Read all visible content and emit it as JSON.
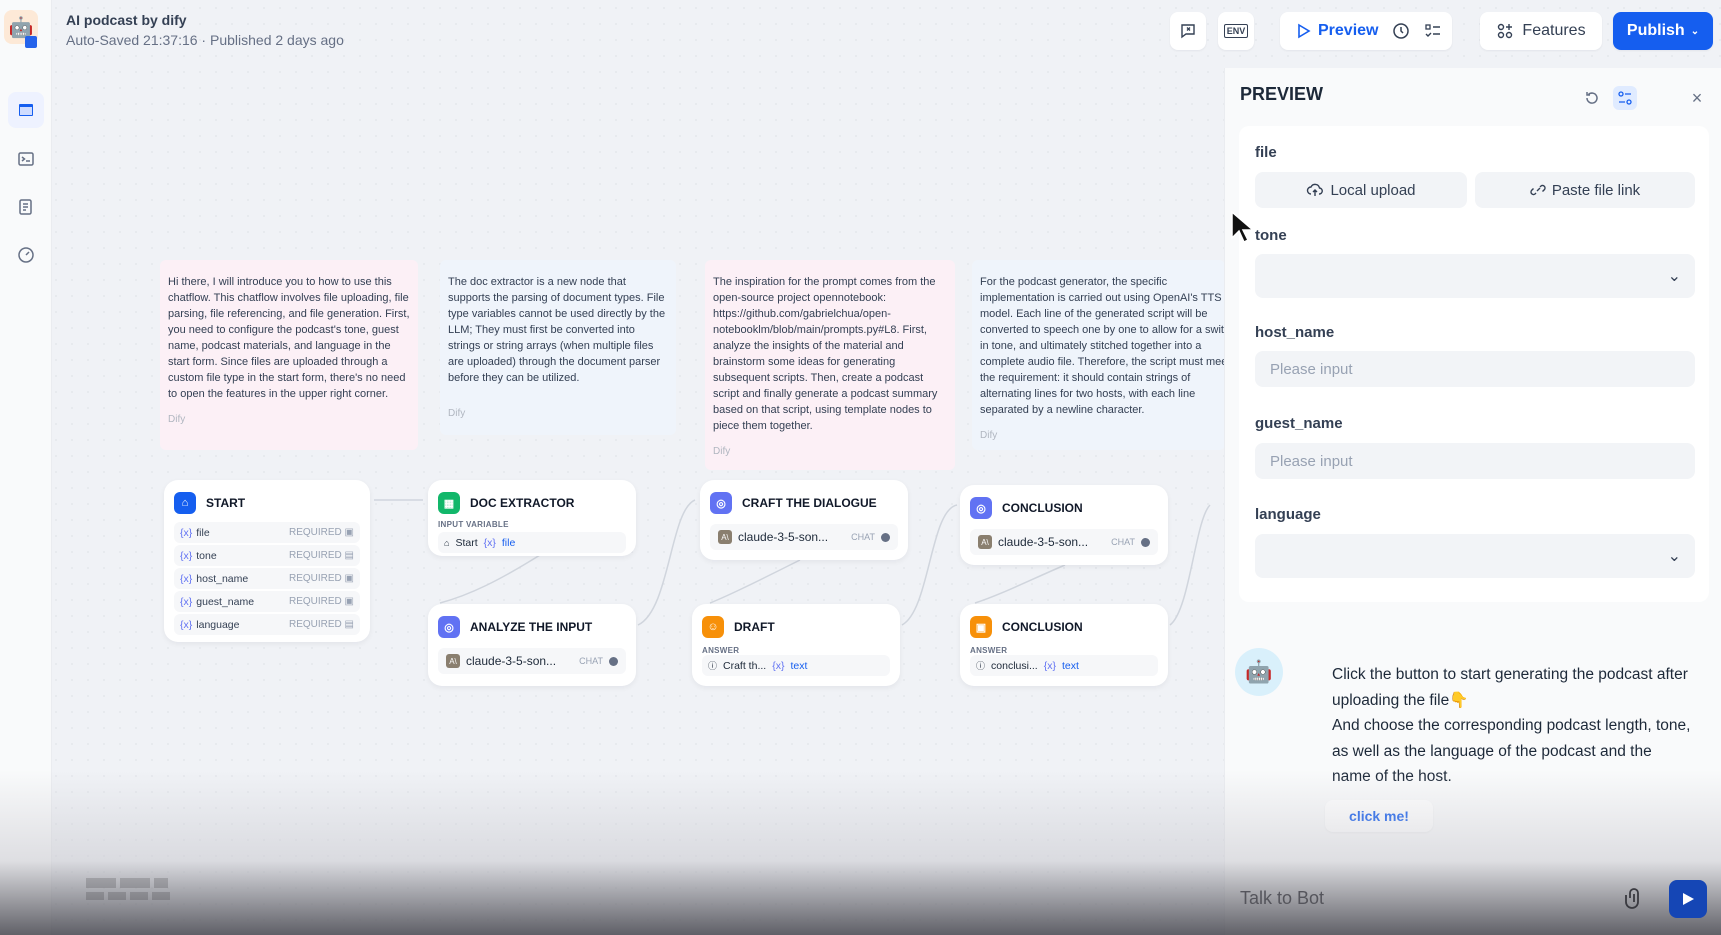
{
  "app": {
    "title": "AI podcast by dify",
    "status": "Auto-Saved 21:37:16 · Published 2 days ago"
  },
  "sidebar": {
    "items": [
      {
        "name": "workflow",
        "icon": "workflow-icon",
        "active": true
      },
      {
        "name": "logs",
        "icon": "terminal-icon"
      },
      {
        "name": "annotations",
        "icon": "document-icon"
      },
      {
        "name": "monitoring",
        "icon": "gauge-icon"
      }
    ]
  },
  "toolbar": {
    "conversation_vars_icon": "conversation-variables-icon",
    "env_label": "ENV",
    "preview_label": "Preview",
    "history_icon": "run-history-icon",
    "checklist_icon": "checklist-icon",
    "features_label": "Features",
    "publish_label": "Publish"
  },
  "notes": [
    {
      "text": "Hi there, I will introduce you to how to use this chatflow. This chatflow involves file uploading, file parsing, file referencing, and file generation. First, you need to configure the podcast's tone, guest name, podcast materials, and language in the start form. Since files are uploaded through a custom file type in the start form, there's no need to open the features in the upper right corner.",
      "author": "Dify"
    },
    {
      "text": "The doc extractor is a new node that supports the parsing of document types. File type variables cannot be used directly by the LLM; They must first be converted into strings or string arrays (when multiple files are uploaded) through the document parser before they can be utilized.",
      "author": "Dify"
    },
    {
      "text": "The inspiration for the prompt comes from the open-source project opennotebook: https://github.com/gabrielchua/open-notebooklm/blob/main/prompts.py#L8. First, analyze the insights of the material and brainstorm some ideas for generating subsequent scripts. Then, create a podcast script and finally generate a podcast summary based on that script, using template nodes to piece them together.",
      "author": "Dify"
    },
    {
      "text": "For the podcast generator, the specific implementation is carried out using OpenAI's TTS model. Each line of the generated script will be converted to speech one by one to allow for a switch in tone, and ultimately stitched together into a complete audio file. Therefore, the script must meet the requirement: it should contain strings of alternating lines for two hosts, with each line separated by a newline character.",
      "author": "Dify"
    }
  ],
  "nodes": {
    "start": {
      "title": "START",
      "variables": [
        {
          "name": "file",
          "req": "REQUIRED"
        },
        {
          "name": "tone",
          "req": "REQUIRED"
        },
        {
          "name": "host_name",
          "req": "REQUIRED"
        },
        {
          "name": "guest_name",
          "req": "REQUIRED"
        },
        {
          "name": "language",
          "req": "REQUIRED"
        }
      ]
    },
    "doc_extractor": {
      "title": "DOC EXTRACTOR",
      "input_label": "INPUT VARIABLE",
      "source": "Start",
      "var": "file"
    },
    "analyze": {
      "title": "ANALYZE THE INPUT",
      "model": "claude-3-5-son...",
      "mode": "CHAT"
    },
    "craft": {
      "title": "CRAFT THE DIALOGUE",
      "model": "claude-3-5-son...",
      "mode": "CHAT"
    },
    "draft": {
      "title": "DRAFT",
      "answer_label": "ANSWER",
      "source": "Craft th...",
      "var": "text"
    },
    "conclusion_llm": {
      "title": "CONCLUSION",
      "model": "claude-3-5-son...",
      "mode": "CHAT"
    },
    "conclusion_answer": {
      "title": "CONCLUSION",
      "answer_label": "ANSWER",
      "source": "conclusi...",
      "var": "text"
    }
  },
  "preview": {
    "title": "PREVIEW",
    "form": {
      "file_label": "file",
      "local_upload": "Local upload",
      "paste_link": "Paste file link",
      "tone_label": "tone",
      "tone_value": "",
      "host_label": "host_name",
      "host_placeholder": "Please input",
      "guest_label": "guest_name",
      "guest_placeholder": "Please input",
      "language_label": "language",
      "language_value": ""
    },
    "bot_message": "Click the button to start generating the podcast after uploading the file👇\nAnd choose the corresponding podcast length, tone, as well as the language of the podcast and the name of the host.",
    "click_me": "click me!",
    "input_placeholder": "Talk to Bot"
  },
  "colors": {
    "accent": "#155eef",
    "start_icon": "#155eef",
    "doc_extractor_icon": "#12b76a",
    "llm_icon": "#6172f3",
    "answer_icon": "#f79009"
  }
}
